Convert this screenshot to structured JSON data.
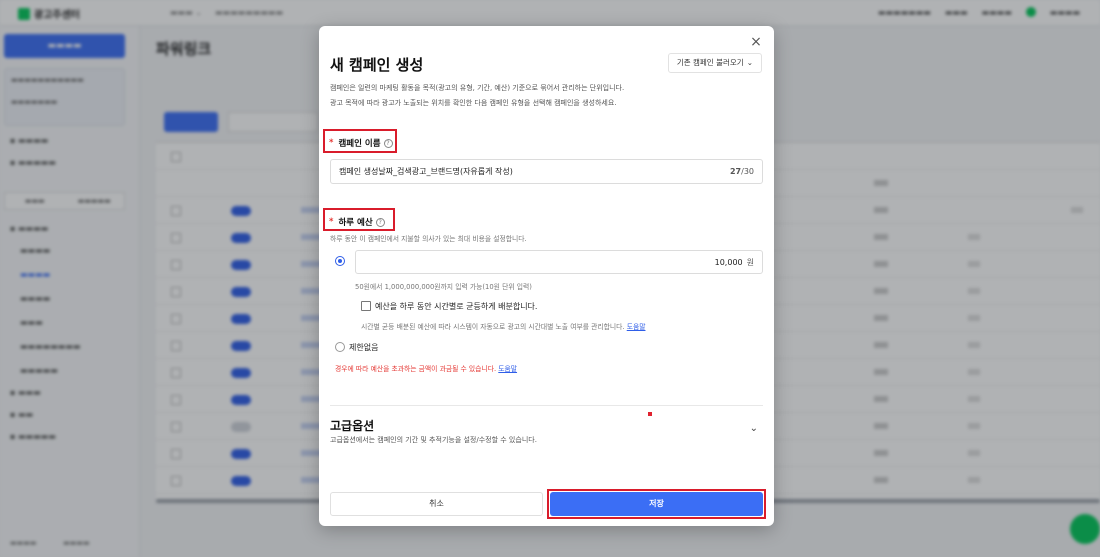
{
  "modal": {
    "title": "새 캠페인 생성",
    "load_button": "기존 캠페인 불러오기",
    "description_line1": "캠페인은 일련의 마케팅 활동을 목적(광고의 유형, 기간, 예산) 기준으로 묶어서 관리하는 단위입니다.",
    "description_line2": "광고 목적에 따라 광고가 노출되는 위치를 확인한 다음 캠페인 유형을 선택해 캠페인을 생성하세요.",
    "required_mark": "*",
    "help_glyph": "?",
    "close_glyph": "×",
    "chevron_glyph": "⌄",
    "campaign_name": {
      "label": "캠페인 이름",
      "value": "캠페인 생성날짜_검색광고_브랜드명(자유롭게 작성)",
      "count_current": "27",
      "count_max": "/30"
    },
    "daily_budget": {
      "label": "하루 예산",
      "hint": "하루 동안 이 캠페인에서 지불할 의사가 있는 최대 비용을 설정합니다.",
      "value": "10,000",
      "unit": "원",
      "range_hint": "50원에서 1,000,000,000원까지 입력 가능(10원 단위 입력)",
      "distribute_label": "예산을 하루 동안 시간별로 균등하게 배분합니다.",
      "distribute_hint": "시간별 균등 배분된 예산에 따라 시스템이 자동으로 광고의 시간대별 노출 여부를 관리합니다.",
      "help_link": "도움말",
      "no_limit_label": "제한없음",
      "warning": "경우에 따라 예산을 초과하는 금액이 과금될 수 있습니다.",
      "warning_link": "도움말"
    },
    "advanced": {
      "title": "고급옵션",
      "description": "고급옵션에서는 캠페인의 기간 및 추적기능을 설정/수정할 수 있습니다."
    },
    "footer": {
      "cancel": "취소",
      "save": "저장"
    }
  },
  "background": {
    "logo": "광고주센터",
    "page_title": "파워링크"
  },
  "colors": {
    "primary": "#3b6ef5",
    "highlight": "#d91c2b",
    "warning": "#e53935",
    "brand": "#03c75a"
  }
}
